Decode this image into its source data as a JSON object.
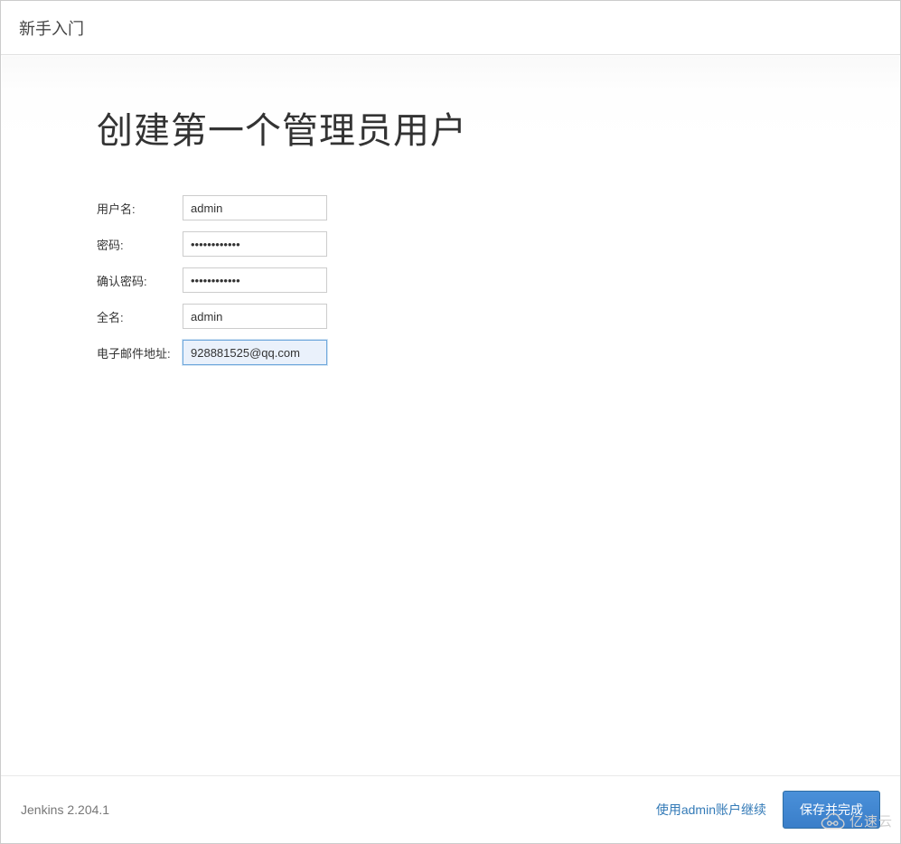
{
  "header": {
    "title": "新手入门"
  },
  "main": {
    "heading": "创建第一个管理员用户",
    "form": {
      "username": {
        "label": "用户名:",
        "value": "admin"
      },
      "password": {
        "label": "密码:",
        "value": "••••••••••••"
      },
      "confirm_password": {
        "label": "确认密码:",
        "value": "••••••••••••"
      },
      "fullname": {
        "label": "全名:",
        "value": "admin"
      },
      "email": {
        "label": "电子邮件地址:",
        "value": "928881525@qq.com"
      }
    }
  },
  "footer": {
    "version": "Jenkins 2.204.1",
    "continue_as_admin": "使用admin账户继续",
    "primary_button": "保存并完成"
  },
  "watermark": {
    "text": "亿速云"
  }
}
